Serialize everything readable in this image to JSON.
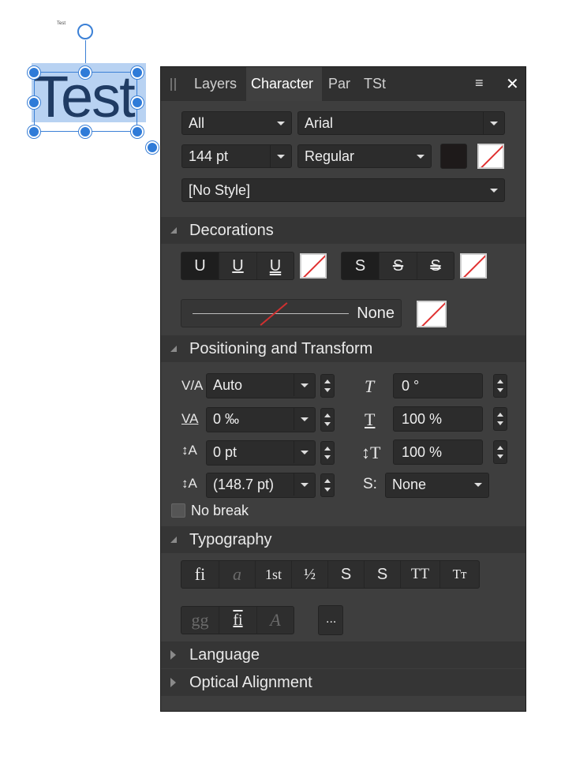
{
  "canvas": {
    "label": "Test",
    "text": "Test"
  },
  "tabs": [
    "Layers",
    "Character",
    "Par",
    "TSt"
  ],
  "top": {
    "scope": "All",
    "font": "Arial",
    "size": "144 pt",
    "weight": "Regular",
    "style": "[No Style]"
  },
  "sections": {
    "decorations": "Decorations",
    "positioning": "Positioning and Transform",
    "typography": "Typography",
    "language": "Language",
    "optical": "Optical Alignment"
  },
  "decorations": {
    "underline": [
      "U",
      "U",
      "U"
    ],
    "strike": [
      "S",
      "S",
      "S"
    ],
    "line_style": "None"
  },
  "positioning": {
    "kerning": "Auto",
    "tracking": "0 ‰",
    "baseline": "0 pt",
    "leading": "(148.7 pt)",
    "shear": "0 °",
    "h_scale": "100 %",
    "v_scale": "100 %",
    "sub_super": "None",
    "no_break": "No break"
  },
  "typography": {
    "row1": [
      "fi",
      "a",
      "1st",
      "½",
      "S",
      "S",
      "TT",
      "Tт"
    ],
    "row2": [
      "gg",
      "fi",
      "A"
    ],
    "more": "..."
  },
  "colors": {
    "accent": "#3b80d6",
    "panel": "#3e3e3e",
    "fill_swatch": "#1e1a1a"
  }
}
